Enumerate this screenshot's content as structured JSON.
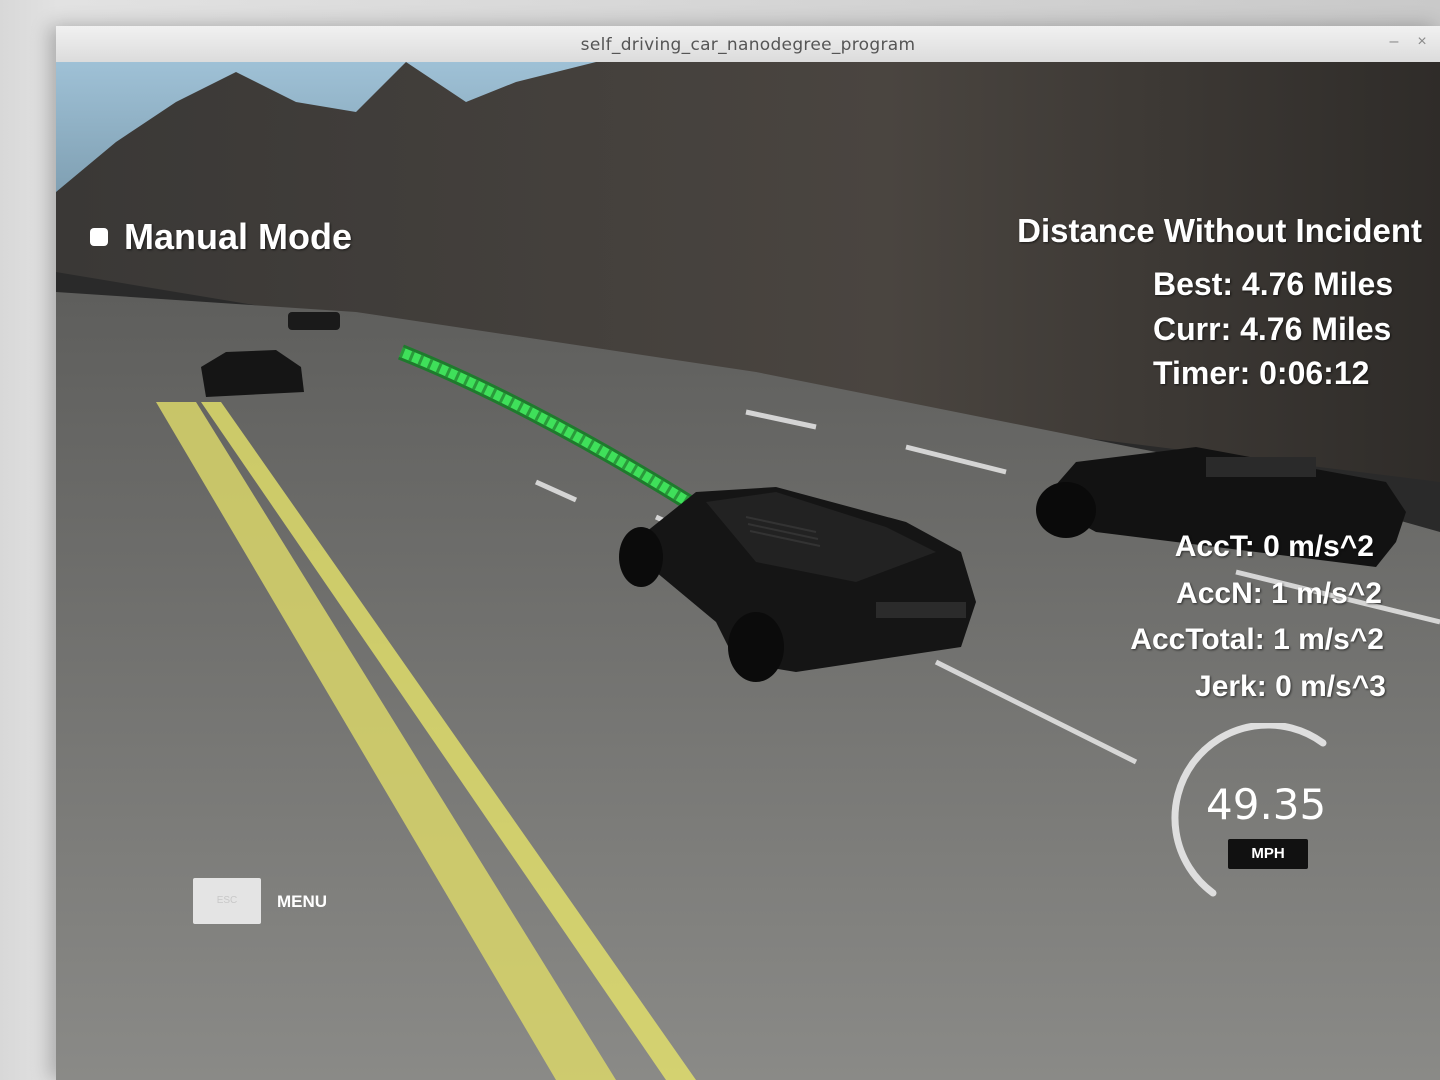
{
  "window": {
    "title": "self_driving_car_nanodegree_program",
    "minimize_glyph": "–",
    "close_glyph": "×"
  },
  "hud": {
    "mode": "Manual Mode",
    "distance_title": "Distance Without Incident",
    "best": "Best: 4.76 Miles",
    "curr": "Curr: 4.76 Miles",
    "timer": "Timer: 0:06:12",
    "acc_t": "AccT: 0 m/s^2",
    "acc_n": "AccN: 1 m/s^2",
    "acc_total": "AccTotal: 1 m/s^2",
    "jerk": "Jerk: 0 m/s^3"
  },
  "speedometer": {
    "value": "49.35",
    "unit": "MPH"
  },
  "menu": {
    "esc_label": "ESC",
    "menu_label": "MENU"
  },
  "colors": {
    "path": "#3fe05a",
    "lane_yellow": "#e6e46a",
    "hud_text": "#ffffff"
  }
}
